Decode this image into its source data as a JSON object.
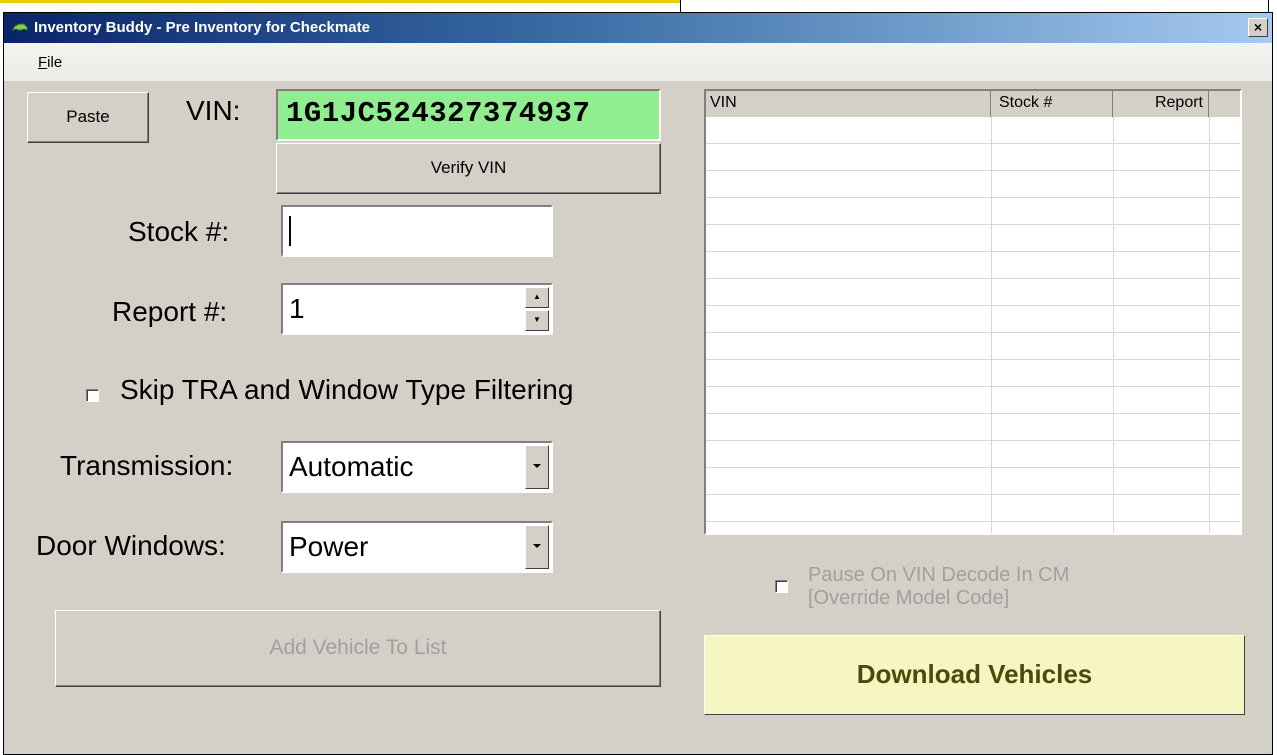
{
  "window": {
    "title": "Inventory Buddy - Pre Inventory for Checkmate",
    "close_label": "×"
  },
  "menu": {
    "file_accel": "F",
    "file_rest": "ile"
  },
  "form": {
    "paste_label": "Paste",
    "vin_label": "VIN:",
    "vin_value": "1G1JC524327374937",
    "vin_bg": "#90ee90",
    "verify_label": "Verify VIN",
    "stock_label": "Stock #:",
    "stock_value": "",
    "report_label": "Report #:",
    "report_value": "1",
    "skip_label": "Skip TRA and Window Type Filtering",
    "skip_checked": false,
    "transmission_label": "Transmission:",
    "transmission_value": "Automatic",
    "door_label": "Door Windows:",
    "door_value": "Power",
    "add_label": "Add Vehicle To List"
  },
  "list": {
    "columns": [
      "VIN",
      "Stock #",
      "Report"
    ],
    "rows": []
  },
  "options": {
    "pause_line1": "Pause On VIN Decode In CM",
    "pause_line2": "[Override Model Code]",
    "pause_checked": false
  },
  "download_label": "Download Vehicles",
  "colors": {
    "titlebar": "#0a246a",
    "download_bg": "#f6f6c2",
    "vin_ok": "#90ee90"
  }
}
